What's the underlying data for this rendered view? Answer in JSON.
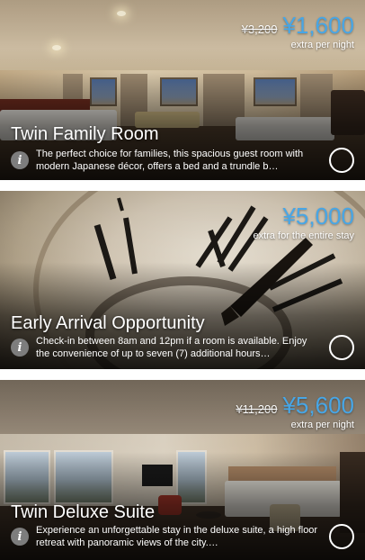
{
  "offers": [
    {
      "title": "Twin Family Room",
      "old_price": "¥3,200",
      "price": "¥1,600",
      "price_note": "extra per night",
      "description": "The perfect choice for families, this spacious guest room with modern Japanese décor, offers a bed and a trundle b…"
    },
    {
      "title": "Early Arrival Opportunity",
      "price": "¥5,000",
      "price_note": "extra for the entire stay",
      "description": "Check-in between 8am and 12pm if a room is available. Enjoy the convenience of up to seven (7) additional hours…"
    },
    {
      "title": "Twin Deluxe Suite",
      "old_price": "¥11,200",
      "price": "¥5,600",
      "price_note": "extra per night",
      "description": "Experience an unforgettable stay in the deluxe suite, a high floor retreat with panoramic views of the city.…"
    }
  ],
  "colors": {
    "price": "#47a6e6",
    "info_icon": "#7d7d7d"
  },
  "icons": {
    "info": "info-icon",
    "select": "select-circle-icon"
  }
}
